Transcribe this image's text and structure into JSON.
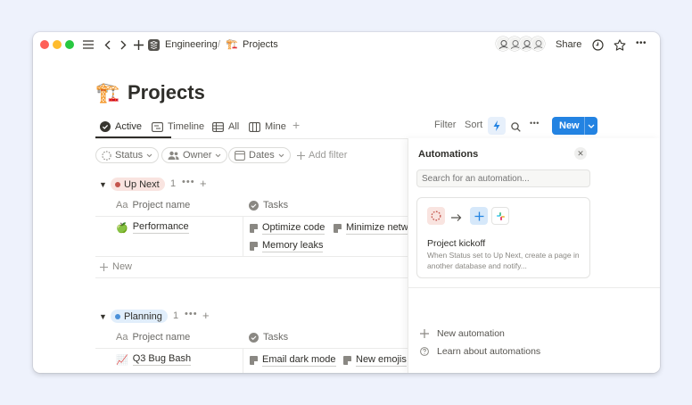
{
  "titlebar": {
    "breadcrumb_workspace": "Engineering",
    "breadcrumb_separator": "/",
    "breadcrumb_page_emoji": "🏗️",
    "breadcrumb_page": "Projects",
    "share_label": "Share",
    "more_glyph": "•••"
  },
  "page": {
    "emoji": "🏗️",
    "title": "Projects"
  },
  "views": {
    "tabs": [
      {
        "label": "Active"
      },
      {
        "label": "Timeline"
      },
      {
        "label": "All"
      },
      {
        "label": "Mine"
      }
    ],
    "add_glyph": "+"
  },
  "toolbar": {
    "filter_label": "Filter",
    "sort_label": "Sort",
    "more_glyph": "•••",
    "new_label": "New"
  },
  "filters": {
    "chips": [
      {
        "label": "Status"
      },
      {
        "label": "Owner"
      },
      {
        "label": "Dates"
      }
    ],
    "add_filter_label": "Add filter"
  },
  "table": {
    "name_prefix": "Aa",
    "name_header": "Project name",
    "tasks_header": "Tasks",
    "new_row_label": "New"
  },
  "groups": [
    {
      "label": "Up Next",
      "count": "1",
      "rows": [
        {
          "emoji": "🍏",
          "name": "Performance",
          "tasks": [
            "Optimize code",
            "Minimize netw",
            "Memory leaks"
          ]
        }
      ]
    },
    {
      "label": "Planning",
      "count": "1",
      "rows": [
        {
          "emoji": "📈",
          "name": "Q3 Bug Bash",
          "tasks": [
            "Email dark mode",
            "New emojis"
          ]
        }
      ]
    }
  ],
  "automations": {
    "title": "Automations",
    "search_placeholder": "Search for an automation...",
    "card": {
      "title": "Project kickoff",
      "description": "When Status set to Up Next, create a page in another database and notify..."
    },
    "new_label": "New automation",
    "learn_label": "Learn about automations"
  },
  "colors": {
    "accent": "#2383e2",
    "up_next_bg": "#f9e4e0",
    "up_next_dot": "#c4554d",
    "planning_bg": "#e1eefb",
    "planning_dot": "#4a90d9"
  }
}
